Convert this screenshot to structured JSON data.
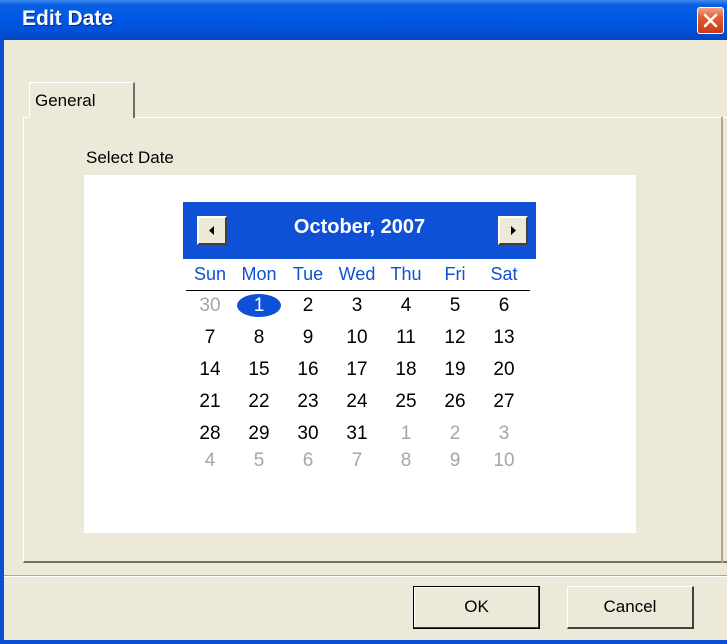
{
  "window": {
    "title": "Edit Date"
  },
  "tabs": [
    {
      "label": "General"
    }
  ],
  "panel": {
    "section_label": "Select Date"
  },
  "calendar": {
    "month_label": "October, 2007",
    "weekdays": [
      "Sun",
      "Mon",
      "Tue",
      "Wed",
      "Thu",
      "Fri",
      "Sat"
    ],
    "selected_day": "1",
    "weeks": [
      [
        {
          "d": "30",
          "other": true
        },
        {
          "d": "1",
          "sel": true
        },
        {
          "d": "2"
        },
        {
          "d": "3"
        },
        {
          "d": "4"
        },
        {
          "d": "5"
        },
        {
          "d": "6"
        }
      ],
      [
        {
          "d": "7"
        },
        {
          "d": "8"
        },
        {
          "d": "9"
        },
        {
          "d": "10"
        },
        {
          "d": "11"
        },
        {
          "d": "12"
        },
        {
          "d": "13"
        }
      ],
      [
        {
          "d": "14"
        },
        {
          "d": "15"
        },
        {
          "d": "16"
        },
        {
          "d": "17"
        },
        {
          "d": "18"
        },
        {
          "d": "19"
        },
        {
          "d": "20"
        }
      ],
      [
        {
          "d": "21"
        },
        {
          "d": "22"
        },
        {
          "d": "23"
        },
        {
          "d": "24"
        },
        {
          "d": "25"
        },
        {
          "d": "26"
        },
        {
          "d": "27"
        }
      ],
      [
        {
          "d": "28"
        },
        {
          "d": "29"
        },
        {
          "d": "30"
        },
        {
          "d": "31"
        },
        {
          "d": "1",
          "other": true
        },
        {
          "d": "2",
          "other": true
        },
        {
          "d": "3",
          "other": true
        }
      ],
      [
        {
          "d": "4",
          "other": true
        },
        {
          "d": "5",
          "other": true
        },
        {
          "d": "6",
          "other": true
        },
        {
          "d": "7",
          "other": true
        },
        {
          "d": "8",
          "other": true
        },
        {
          "d": "9",
          "other": true
        },
        {
          "d": "10",
          "other": true
        }
      ]
    ]
  },
  "buttons": {
    "ok_label": "OK",
    "cancel_label": "Cancel"
  },
  "icons": {
    "close": "close-icon",
    "prev": "triangle-left-icon",
    "next": "triangle-right-icon"
  },
  "colors": {
    "title_bar": "#0058e6",
    "calendar_accent": "#0e51d6",
    "dialog_bg": "#ece9d8",
    "other_month_day": "#a6a6a6"
  }
}
